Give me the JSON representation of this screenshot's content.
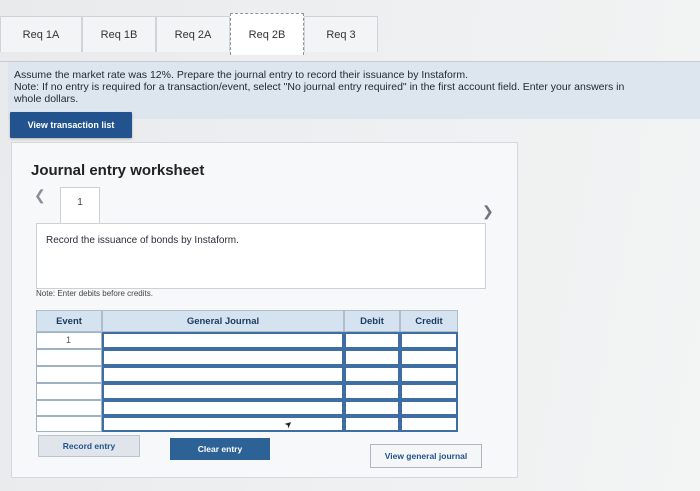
{
  "tabs": [
    {
      "label": "Req 1A"
    },
    {
      "label": "Req 1B"
    },
    {
      "label": "Req 2A"
    },
    {
      "label": "Req 2B"
    },
    {
      "label": "Req 3"
    }
  ],
  "active_tab": "Req 2B",
  "instructions": {
    "line1": "Assume the market rate was 12%. Prepare the journal entry to record their issuance by Instaform.",
    "line2": "Note: If no entry is required for a transaction/event, select \"No journal entry required\" in the first account field. Enter your answers in",
    "line3": "whole dollars."
  },
  "view_transaction_list_label": "View transaction list",
  "worksheet": {
    "title": "Journal entry worksheet",
    "page_number": "1",
    "record_text": "Record the issuance of bonds by Instaform.",
    "note": "Note: Enter debits before credits."
  },
  "grid": {
    "headers": {
      "event": "Event",
      "general_journal": "General Journal",
      "debit": "Debit",
      "credit": "Credit"
    },
    "rows": [
      {
        "event": "1",
        "account": "",
        "debit": "",
        "credit": ""
      },
      {
        "event": "",
        "account": "",
        "debit": "",
        "credit": ""
      },
      {
        "event": "",
        "account": "",
        "debit": "",
        "credit": ""
      },
      {
        "event": "",
        "account": "",
        "debit": "",
        "credit": ""
      },
      {
        "event": "",
        "account": "",
        "debit": "",
        "credit": ""
      },
      {
        "event": "",
        "account": "",
        "debit": "",
        "credit": ""
      }
    ]
  },
  "buttons": {
    "record_entry": "Record entry",
    "clear_entry": "Clear entry",
    "view_general_journal": "View general journal"
  },
  "icons": {
    "prev": "chevron-left-icon",
    "next": "chevron-right-icon"
  },
  "colors": {
    "primary_button": "#23538f",
    "banner": "#dde6ee",
    "grid_header": "#d5e2ef"
  }
}
